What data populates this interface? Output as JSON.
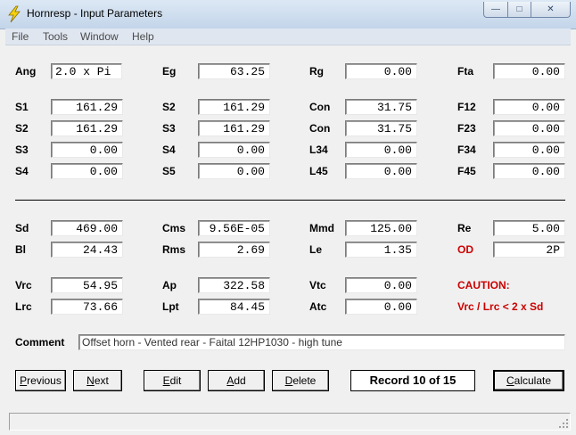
{
  "window": {
    "title": "Hornresp - Input Parameters",
    "controls": {
      "minimize": "—",
      "maximize": "□",
      "close": "✕"
    }
  },
  "menu": [
    "File",
    "Tools",
    "Window",
    "Help"
  ],
  "fields": {
    "ang": {
      "label": "Ang",
      "value": "2.0 x Pi"
    },
    "eg": {
      "label": "Eg",
      "value": "63.25"
    },
    "rg": {
      "label": "Rg",
      "value": "0.00"
    },
    "fta": {
      "label": "Fta",
      "value": "0.00"
    },
    "s1": {
      "label": "S1",
      "value": "161.29"
    },
    "s2a": {
      "label": "S2",
      "value": "161.29"
    },
    "con1": {
      "label": "Con",
      "value": "31.75"
    },
    "f12": {
      "label": "F12",
      "value": "0.00"
    },
    "s2b": {
      "label": "S2",
      "value": "161.29"
    },
    "s3a": {
      "label": "S3",
      "value": "161.29"
    },
    "con2": {
      "label": "Con",
      "value": "31.75"
    },
    "f23": {
      "label": "F23",
      "value": "0.00"
    },
    "s3b": {
      "label": "S3",
      "value": "0.00"
    },
    "s4a": {
      "label": "S4",
      "value": "0.00"
    },
    "l34": {
      "label": "L34",
      "value": "0.00"
    },
    "f34": {
      "label": "F34",
      "value": "0.00"
    },
    "s4b": {
      "label": "S4",
      "value": "0.00"
    },
    "s5": {
      "label": "S5",
      "value": "0.00"
    },
    "l45": {
      "label": "L45",
      "value": "0.00"
    },
    "f45": {
      "label": "F45",
      "value": "0.00"
    },
    "sd": {
      "label": "Sd",
      "value": "469.00"
    },
    "cms": {
      "label": "Cms",
      "value": "9.56E-05"
    },
    "mmd": {
      "label": "Mmd",
      "value": "125.00"
    },
    "re": {
      "label": "Re",
      "value": "5.00"
    },
    "bl": {
      "label": "Bl",
      "value": "24.43"
    },
    "rms": {
      "label": "Rms",
      "value": "2.69"
    },
    "le": {
      "label": "Le",
      "value": "1.35"
    },
    "od": {
      "label": "OD",
      "value": "2P"
    },
    "vrc": {
      "label": "Vrc",
      "value": "54.95"
    },
    "ap": {
      "label": "Ap",
      "value": "322.58"
    },
    "vtc": {
      "label": "Vtc",
      "value": "0.00"
    },
    "lrc": {
      "label": "Lrc",
      "value": "73.66"
    },
    "lpt": {
      "label": "Lpt",
      "value": "84.45"
    },
    "atc": {
      "label": "Atc",
      "value": "0.00"
    }
  },
  "caution": {
    "title": "CAUTION:",
    "message": "Vrc / Lrc < 2 x Sd"
  },
  "comment": {
    "label": "Comment",
    "value": "Offset horn - Vented rear - Faital 12HP1030 - high tune"
  },
  "buttons": {
    "previous": {
      "u": "P",
      "rest": "revious"
    },
    "next": {
      "u": "N",
      "rest": "ext"
    },
    "edit": {
      "u": "E",
      "rest": "dit"
    },
    "add": {
      "u": "A",
      "rest": "dd"
    },
    "delete": {
      "u": "D",
      "rest": "elete"
    },
    "calculate": {
      "u": "C",
      "rest": "alculate"
    }
  },
  "record": "Record 10 of 15",
  "colors": {
    "caution": "#cc0000",
    "od_label": "#cc0000"
  }
}
